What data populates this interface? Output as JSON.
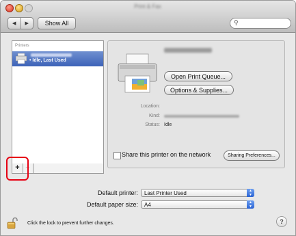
{
  "window": {
    "title": "Print & Fax"
  },
  "toolbar": {
    "back_glyph": "◀",
    "forward_glyph": "▶",
    "show_all_label": "Show All",
    "search_icon": "magnifier-icon",
    "search_glyph": "⚲",
    "search_value": ""
  },
  "sidebar": {
    "header": "Printers",
    "printers": [
      {
        "name": "",
        "status": "• Idle, Last Used"
      }
    ],
    "add_label": "+",
    "remove_label": "−"
  },
  "detail": {
    "open_queue_label": "Open Print Queue...",
    "options_label": "Options & Supplies...",
    "location_label": "Location:",
    "kind_label": "Kind:",
    "status_label": "Status:",
    "status_value": "Idle",
    "share_label": "Share this printer on the network",
    "share_checked": false,
    "sharing_prefs_label": "Sharing Preferences..."
  },
  "defaults": {
    "printer_label": "Default printer:",
    "printer_value": "Last Printer Used",
    "paper_label": "Default paper size:",
    "paper_value": "A4"
  },
  "footer": {
    "lock_text": "Click the lock to prevent further changes.",
    "help_label": "?"
  },
  "colors": {
    "selection": "#4a6fc2",
    "highlight_annotation": "#e60012"
  }
}
